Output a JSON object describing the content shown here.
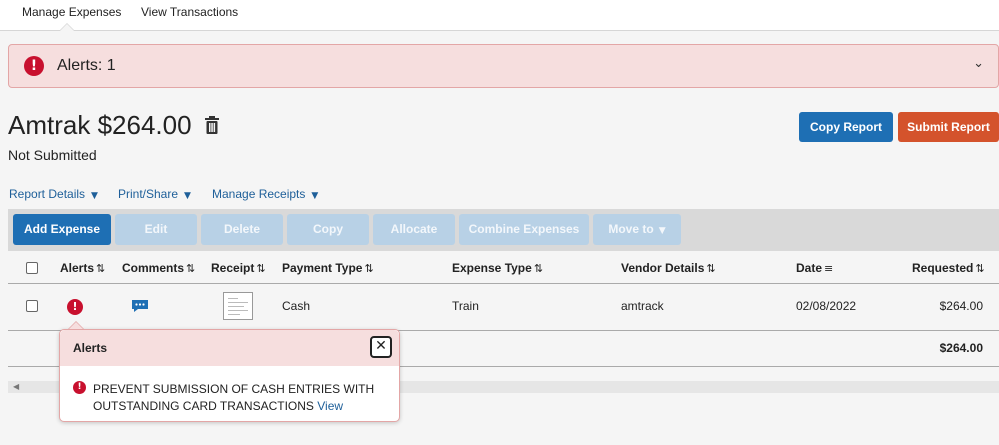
{
  "nav": {
    "tabs": [
      "Manage Expenses",
      "View Transactions"
    ]
  },
  "alert_bar": {
    "text": "Alerts: 1"
  },
  "report": {
    "title": "Amtrak $264.00",
    "status": "Not Submitted",
    "copy_label": "Copy Report",
    "submit_label": "Submit Report"
  },
  "colors": {
    "primary": "#1e6fb4",
    "submit": "#d4532c",
    "alert": "#c8102e",
    "alert_bg": "#f6dede"
  },
  "menus": [
    "Report Details",
    "Print/Share",
    "Manage Receipts"
  ],
  "toolbar": [
    "Add Expense",
    "Edit",
    "Delete",
    "Copy",
    "Allocate",
    "Combine Expenses",
    "Move to"
  ],
  "table": {
    "headers": [
      "Alerts",
      "Comments",
      "Receipt",
      "Payment Type",
      "Expense Type",
      "Vendor Details",
      "Date",
      "Requested"
    ],
    "rows": [
      {
        "payment_type": "Cash",
        "expense_type": "Train",
        "vendor": "amtrack",
        "date": "02/08/2022",
        "requested": "$264.00"
      }
    ],
    "total": "$264.00"
  },
  "popover": {
    "title": "Alerts",
    "message": "PREVENT SUBMISSION OF CASH ENTRIES WITH OUTSTANDING CARD TRANSACTIONS",
    "link": "View"
  },
  "icons": [
    "alert-icon",
    "chevron-down-icon",
    "trash-icon",
    "sort-icon",
    "comment-icon",
    "receipt-icon",
    "close-icon",
    "scroll-left-icon"
  ]
}
